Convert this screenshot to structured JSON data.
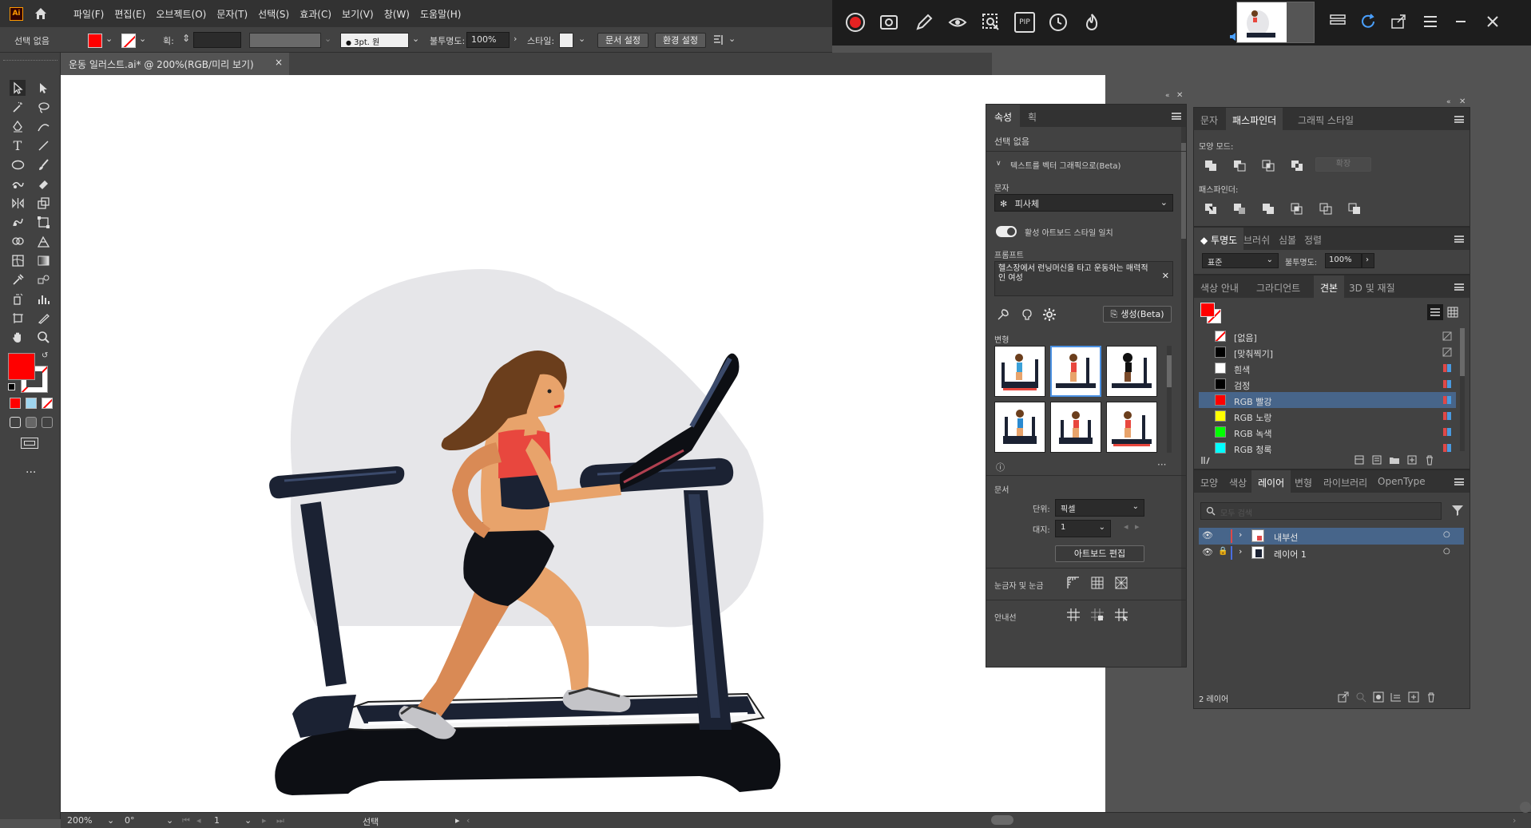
{
  "app": {
    "logo": "Ai"
  },
  "menu": [
    "파일(F)",
    "편집(E)",
    "오브젝트(O)",
    "문자(T)",
    "선택(S)",
    "효과(C)",
    "보기(V)",
    "창(W)",
    "도움말(H)"
  ],
  "control_bar": {
    "selection": "선택 없음",
    "stroke_label": "획:",
    "brush_value": "3pt. 원",
    "opacity_label": "불투명도:",
    "opacity_value": "100%",
    "style_label": "스타일:",
    "doc_setup": "문서 설정",
    "preferences": "환경 설정"
  },
  "document_tab": {
    "title": "운동 일러스트.ai* @ 200%(RGB/미리 보기)",
    "close": "×"
  },
  "recorder": {
    "pip": "PIP"
  },
  "properties": {
    "tabs": [
      "속성",
      "획"
    ],
    "no_selection": "선택 없음",
    "text_to_vector": "텍스트를 벡터 그래픽으로(Beta)",
    "type_label": "문자",
    "type_value": "피사체",
    "match_style": "활성 아트보드 스타일 일치",
    "prompt_label": "프롬프트",
    "prompt_text": "헬스장에서 런닝머신을 타고 운동하는 매력적인 여성",
    "generate": "생성(Beta)",
    "variations_label": "변형",
    "document_label": "문서",
    "units_label": "단위:",
    "units_value": "픽셀",
    "artboard_label": "대지:",
    "artboard_value": "1",
    "edit_artboards": "아트보드 편집",
    "rulers_grids": "눈금자 및 눈금",
    "guides": "안내선"
  },
  "pathfinder_panel": {
    "tabs": [
      "문자",
      "패스파인더",
      "그래픽 스타일"
    ],
    "shape_modes": "모양 모드:",
    "expand": "확장",
    "pathfinders": "패스파인더:"
  },
  "transparency_panel": {
    "tabs": [
      "투명도",
      "브러쉬",
      "심볼",
      "정렬"
    ],
    "blend_mode": "표준",
    "opacity_label": "불투명도:",
    "opacity_value": "100%"
  },
  "swatches_panel": {
    "tabs": [
      "색상 안내",
      "그라디언트",
      "견본",
      "3D 및 재질"
    ],
    "swatches": [
      {
        "name": "[없음]",
        "color": "none"
      },
      {
        "name": "[맞춰찍기]",
        "color": "#000000"
      },
      {
        "name": "흰색",
        "color": "#ffffff"
      },
      {
        "name": "검정",
        "color": "#000000"
      },
      {
        "name": "RGB 빨강",
        "color": "#ff0000"
      },
      {
        "name": "RGB 노랑",
        "color": "#ffff00"
      },
      {
        "name": "RGB 녹색",
        "color": "#00ff00"
      },
      {
        "name": "RGB 청록",
        "color": "#00ffff"
      }
    ]
  },
  "layers_panel": {
    "tabs": [
      "모양",
      "색상",
      "레이어",
      "변형",
      "라이브러리",
      "OpenType"
    ],
    "search_placeholder": "모두 검색",
    "layers": [
      {
        "name": "내부선",
        "color": "#e04848"
      },
      {
        "name": "레이어 1",
        "color": "#4a6ee0"
      }
    ],
    "count": "2 레이어"
  },
  "status_bar": {
    "zoom": "200%",
    "rotation": "0°",
    "artboard": "1",
    "tool": "선택"
  },
  "colors": {
    "fill": "#ff0000",
    "accent": "#47658a",
    "sports_top": "#e8473e",
    "skin": "#e8a36b",
    "hair": "#6b3e1c",
    "machine": "#1b2233"
  }
}
